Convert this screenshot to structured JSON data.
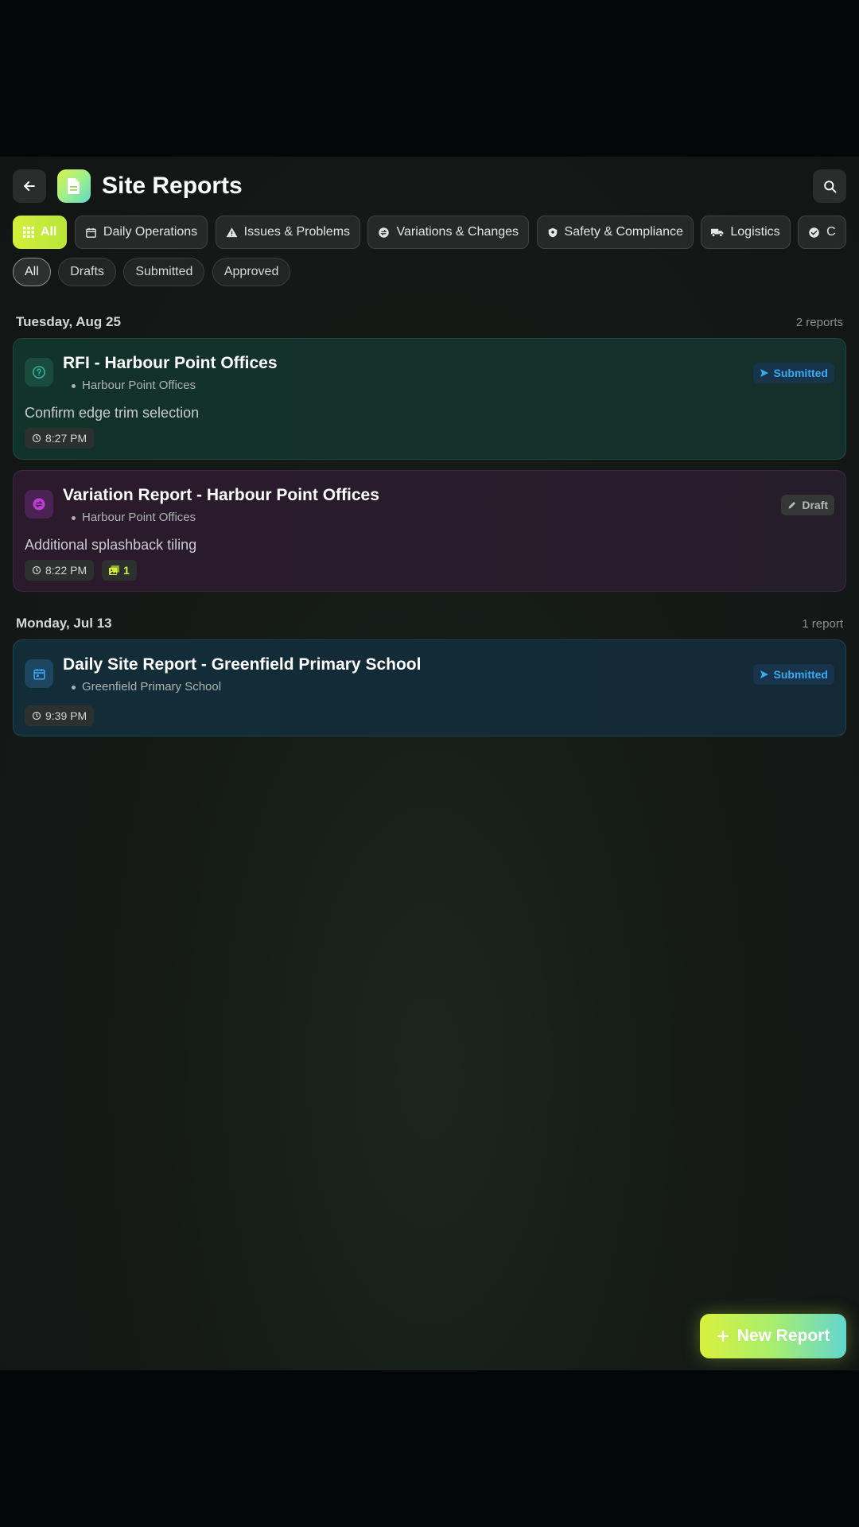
{
  "header": {
    "title": "Site Reports"
  },
  "categories": [
    {
      "label": "All",
      "icon": "grid-icon",
      "active": true
    },
    {
      "label": "Daily Operations",
      "icon": "calendar-icon"
    },
    {
      "label": "Issues & Problems",
      "icon": "warning-icon"
    },
    {
      "label": "Variations & Changes",
      "icon": "swap-icon"
    },
    {
      "label": "Safety & Compliance",
      "icon": "shield-icon"
    },
    {
      "label": "Logistics",
      "icon": "truck-icon"
    },
    {
      "label": "C",
      "icon": "check-circle-icon"
    }
  ],
  "status_filters": [
    {
      "label": "All",
      "active": true
    },
    {
      "label": "Drafts"
    },
    {
      "label": "Submitted"
    },
    {
      "label": "Approved"
    }
  ],
  "sections": [
    {
      "date": "Tuesday, Aug 25",
      "count": "2 reports",
      "reports": [
        {
          "title": "RFI - Harbour Point Offices",
          "project": "Harbour Point Offices",
          "description": "Confirm edge trim selection",
          "status": "Submitted",
          "time": "8:27 PM"
        },
        {
          "title": "Variation Report - Harbour Point Offices",
          "project": "Harbour Point Offices",
          "description": "Additional splashback tiling",
          "status": "Draft",
          "time": "8:22 PM",
          "photos": "1"
        }
      ]
    },
    {
      "date": "Monday, Jul 13",
      "count": "1 report",
      "reports": [
        {
          "title": "Daily Site Report - Greenfield Primary School",
          "project": "Greenfield Primary School",
          "status": "Submitted",
          "time": "9:39 PM"
        }
      ]
    }
  ],
  "fab": {
    "label": "New Report"
  },
  "colors": {
    "accent": "#d4ee3a",
    "submitted": "#3aa9f2",
    "rfi": "#2fb79a",
    "variation": "#c13bd4",
    "daily": "#3aa9f2"
  }
}
